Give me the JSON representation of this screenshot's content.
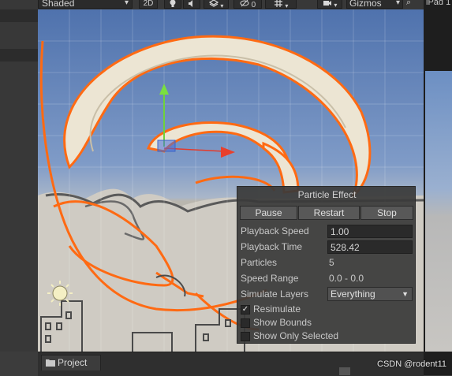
{
  "toolbar": {
    "shading_mode": "Shaded",
    "two_d_label": "2D",
    "effects_count": "0",
    "gizmos_label": "Gizmos",
    "icons": [
      "lightbulb-icon",
      "speaker-icon",
      "layers-icon",
      "eye-slash-icon",
      "grid-icon",
      "camera-icon",
      "gizmos-dropdown-icon"
    ]
  },
  "game_view": {
    "tab_label": "iPad 1"
  },
  "particle_effect": {
    "title": "Particle Effect",
    "buttons": {
      "pause": "Pause",
      "restart": "Restart",
      "stop": "Stop"
    },
    "playback_speed": {
      "label": "Playback Speed",
      "value": "1.00"
    },
    "playback_time": {
      "label": "Playback Time",
      "value": "528.42"
    },
    "particles": {
      "label": "Particles",
      "value": "5"
    },
    "speed_range": {
      "label": "Speed Range",
      "value": "0.0 - 0.0"
    },
    "simulate_layers": {
      "label": "Simulate Layers",
      "value": "Everything"
    },
    "resimulate": {
      "label": "Resimulate",
      "checked": true
    },
    "show_bounds": {
      "label": "Show Bounds",
      "checked": false
    },
    "show_only_selected": {
      "label": "Show Only Selected",
      "checked": false
    }
  },
  "bottom": {
    "project_tab": "Project",
    "project_icon": "folder-icon"
  },
  "watermark": "CSDN @rodent11",
  "colors": {
    "outline": "#ff6a13",
    "sky_top": "#587ab8",
    "ground": "#cfcbc3",
    "panel": "#3a3a3a"
  }
}
